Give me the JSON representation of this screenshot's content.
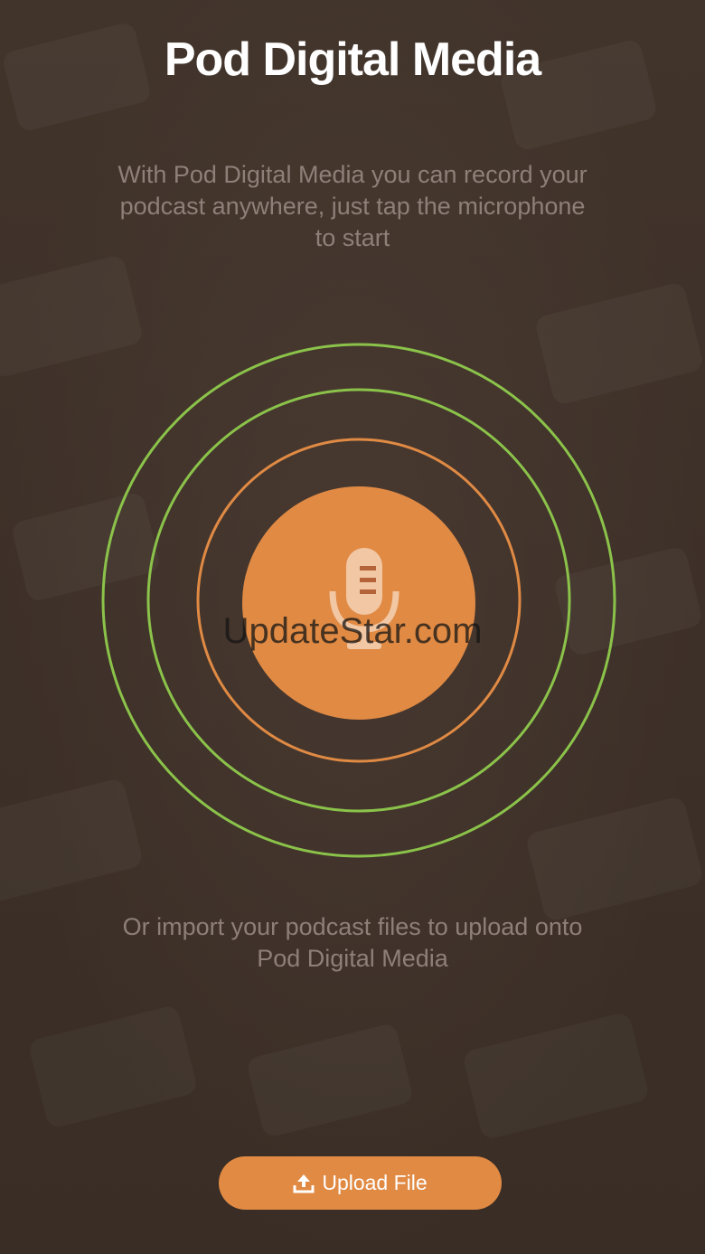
{
  "app": {
    "title": "Pod Digital Media",
    "intro_text": "With Pod Digital Media you can record your podcast anywhere, just tap the microphone to start",
    "import_text": "Or import your podcast files to upload onto Pod Digital Media"
  },
  "record": {
    "icon": "microphone-icon"
  },
  "upload": {
    "label": "Upload File",
    "icon": "upload-icon"
  },
  "watermark": "UpdateStar.com",
  "colors": {
    "background": "#3e3129",
    "accent_orange": "#e08a44",
    "ring_green": "#8bc34a",
    "ring_orange": "#e08a44",
    "muted_text": "#8e8079",
    "mic_icon": "#f2c7a3"
  }
}
